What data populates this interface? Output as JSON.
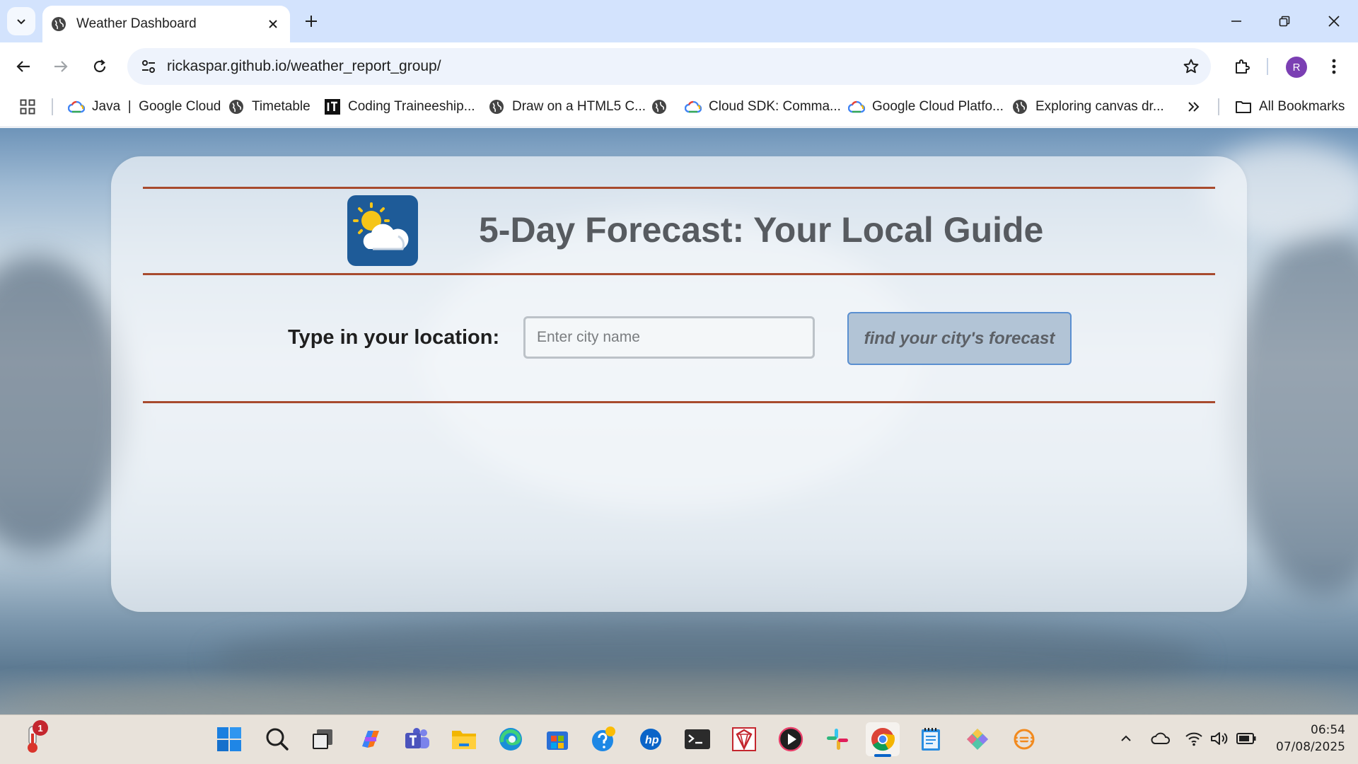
{
  "browser": {
    "tab_title": "Weather Dashboard",
    "url": "rickaspar.github.io/weather_report_group/",
    "profile_initial": "R",
    "bookmarks": [
      {
        "label": "Java  |  Google Cloud",
        "icon": "google-cloud-icon"
      },
      {
        "label": "Timetable",
        "icon": "globe-icon"
      },
      {
        "label": "Coding Traineeship...",
        "icon": "it-logo-icon"
      },
      {
        "label": "Draw on a HTML5 C...",
        "icon": "globe-icon"
      },
      {
        "label": "",
        "icon": "globe-icon"
      },
      {
        "label": "Cloud SDK: Comma...",
        "icon": "google-cloud-icon"
      },
      {
        "label": "Google Cloud Platfo...",
        "icon": "google-cloud-icon"
      },
      {
        "label": "Exploring canvas dr...",
        "icon": "globe-icon"
      }
    ],
    "all_bookmarks": "All Bookmarks"
  },
  "page": {
    "headline": "5-Day Forecast: Your Local Guide",
    "location_label": "Type in your location:",
    "city_placeholder": "Enter city name",
    "city_value": "",
    "find_button": "find your city's forecast"
  },
  "taskbar": {
    "weather_badge": "1",
    "time": "06:54",
    "date": "07/08/2025",
    "apps": [
      "start",
      "search",
      "task-view",
      "copilot",
      "teams",
      "file-explorer",
      "edge",
      "microsoft-store",
      "help",
      "hp",
      "terminal",
      "ruby-mine",
      "media-player",
      "slack",
      "chrome",
      "notepad",
      "gitkraken",
      "eclipse"
    ]
  },
  "colors": {
    "accent_rule": "#a84b2e",
    "logo_bg": "#1e5b98",
    "button_bg": "#b2c4d6",
    "button_border": "#5a8fd0"
  }
}
